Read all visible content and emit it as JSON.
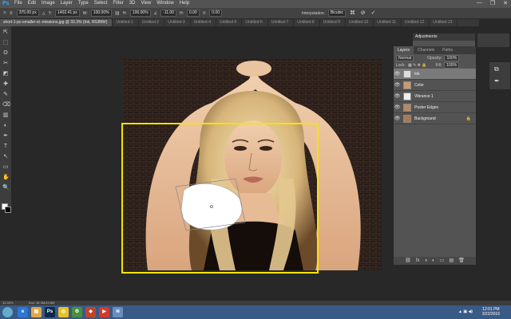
{
  "app": {
    "logo": "Ps",
    "menu": [
      "File",
      "Edit",
      "Image",
      "Layer",
      "Type",
      "Select",
      "Filter",
      "3D",
      "View",
      "Window",
      "Help"
    ],
    "window_controls": [
      "—",
      "❐",
      "✕"
    ]
  },
  "options": {
    "x_label": "X:",
    "x_value": "375.00 px",
    "y_label": "Y:",
    "y_value": "1402.41 px",
    "w_label": "W:",
    "w_value": "100.00%",
    "h_label": "H:",
    "h_value": "100.00%",
    "angle_value": "-11.00",
    "hskew_label": "H:",
    "hskew_value": "0.00",
    "vskew_label": "V:",
    "vskew_value": "0.00",
    "interp_label": "Interpolation:",
    "interp_value": "Bicubic",
    "cancel_icon": "⊘",
    "commit_icon": "✓"
  },
  "tabs": [
    {
      "label": "short-1-pc-smaller-st.-missions.jpg @ 33.3% (Ink, RGB/8#)",
      "active": true
    },
    {
      "label": "Untitled-1"
    },
    {
      "label": "Untitled-2"
    },
    {
      "label": "Untitled-3"
    },
    {
      "label": "Untitled-4"
    },
    {
      "label": "Untitled-5"
    },
    {
      "label": "Untitled-6"
    },
    {
      "label": "Untitled-7"
    },
    {
      "label": "Untitled-8"
    },
    {
      "label": "Untitled-9"
    },
    {
      "label": "Untitled-10"
    },
    {
      "label": "Untitled-11"
    },
    {
      "label": "Untitled-12"
    },
    {
      "label": "Untitled-13"
    }
  ],
  "tools": [
    "⇱",
    "⬚",
    "ʘ",
    "✂",
    "◩",
    "✚",
    "✎",
    "⌫",
    "▥",
    "◐",
    "✒",
    "T",
    "↖",
    "▭",
    "✋",
    "🔍"
  ],
  "adjustments": {
    "title": "Adjustments"
  },
  "layers_panel": {
    "tabs": [
      "Layers",
      "Channels",
      "Paths"
    ],
    "blend_mode": "Normal",
    "opacity_label": "Opacity:",
    "opacity_value": "100%",
    "lock_label": "Lock:",
    "fill_label": "Fill:",
    "fill_value": "100%",
    "layers": [
      {
        "name": "Ink",
        "active": true,
        "thumb": "#ddd"
      },
      {
        "name": "Color",
        "thumb": "#c99a70"
      },
      {
        "name": "Vibrance 1",
        "thumb": "#eee"
      },
      {
        "name": "Poster Edges",
        "thumb": "#b58860"
      },
      {
        "name": "Background",
        "thumb": "#a87a55",
        "lock": "🔒"
      }
    ],
    "footer": [
      "⛓",
      "fx",
      "◑",
      "◐",
      "▭",
      "▤",
      "🗑"
    ]
  },
  "status": {
    "zoom": "33.33%",
    "doc": "Doc: 16.3M/43.8M"
  },
  "taskbar": {
    "apps": [
      "e",
      "▤",
      "Ps",
      "◎",
      "⚙",
      "◆",
      "▶",
      "≋"
    ],
    "time": "12:01 PM",
    "date": "3/22/2016"
  }
}
